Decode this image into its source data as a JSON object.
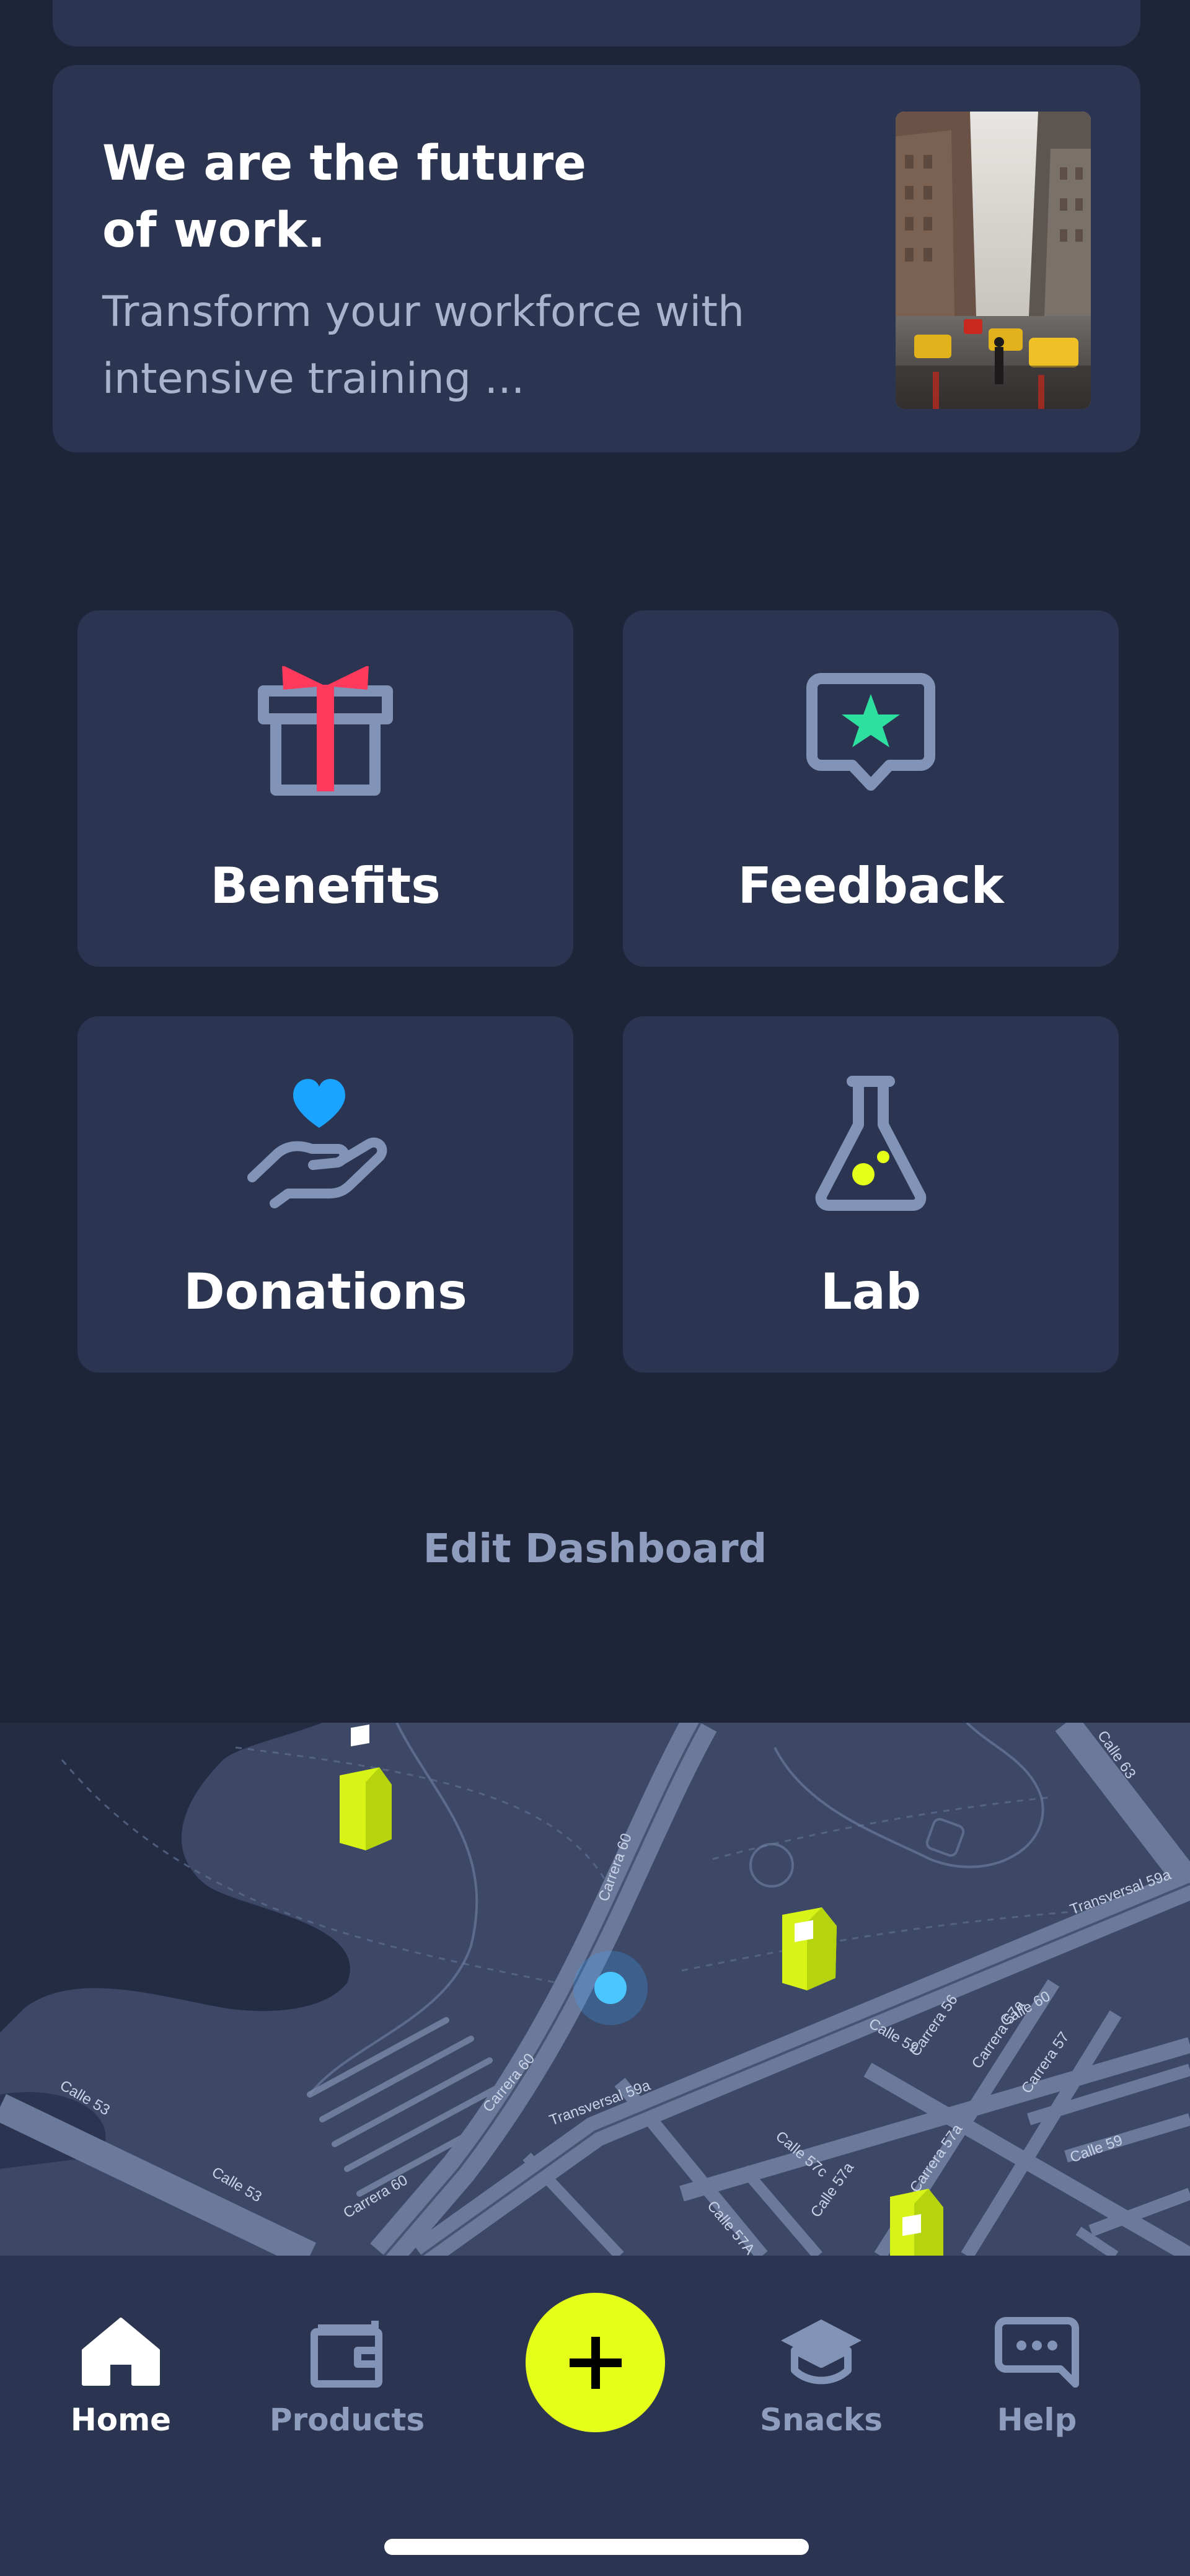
{
  "promo": {
    "title_line1": "We are the future",
    "title_line2": "of work.",
    "subtitle_line1": "Transform your workforce with",
    "subtitle_line2": "intensive training ..."
  },
  "tiles": [
    {
      "label": "Benefits",
      "icon": "gift-icon"
    },
    {
      "label": "Feedback",
      "icon": "star-message-icon"
    },
    {
      "label": "Donations",
      "icon": "heart-hand-icon"
    },
    {
      "label": "Lab",
      "icon": "flask-icon"
    }
  ],
  "edit_dashboard": "Edit Dashboard",
  "map": {
    "street_labels": [
      "Calle 53",
      "Calle 53",
      "Carrera 60",
      "Carrera 60",
      "Carrera 60",
      "Transversal 59a",
      "Transversal 59a",
      "Calle 63",
      "Calle 59",
      "Calle 59",
      "Calle 57c",
      "Calle 57A",
      "Carrera 56",
      "Carrera 57a",
      "Carrera 57",
      "Calle 60",
      "Carrera 57a",
      "Calle 57a"
    ]
  },
  "tabbar": {
    "home": "Home",
    "products": "Products",
    "snacks": "Snacks",
    "help": "Help"
  },
  "colors": {
    "background": "#1f2539",
    "card": "#2b3450",
    "accent_yellow": "#e4ff1a",
    "gift_red": "#ff3a5c",
    "star_green": "#2ee0a0",
    "heart_blue": "#1aa3ff",
    "muted_text": "#8e9dbd"
  }
}
